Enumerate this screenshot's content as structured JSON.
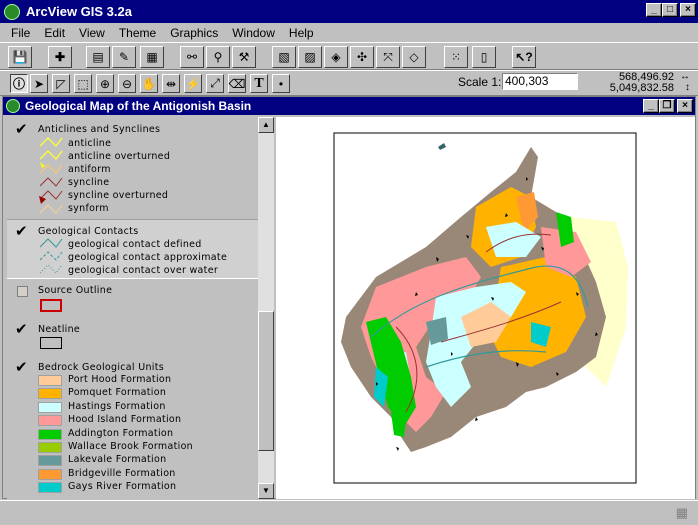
{
  "app": {
    "title": "ArcView GIS 3.2a"
  },
  "menu": [
    "File",
    "Edit",
    "View",
    "Theme",
    "Graphics",
    "Window",
    "Help"
  ],
  "toolbar": {
    "scale_label": "Scale 1:",
    "scale_value": "400,303",
    "x_coord": "568,496.92",
    "y_coord": "5,049,832.58",
    "x_arrow": "↔",
    "y_arrow": "↕"
  },
  "view": {
    "title": "Geological Map of the Antigonish Basin"
  },
  "toc": [
    {
      "name": "Anticlines and Synclines",
      "checked": true,
      "legend": [
        "anticline",
        "anticline overturned",
        "antiform",
        "syncline",
        "syncline overturned",
        "synform"
      ]
    },
    {
      "name": "Geological Contacts",
      "checked": true,
      "legend": [
        "geological contact defined",
        "geological contact approximate",
        "geological contact over water"
      ]
    },
    {
      "name": "Source Outline",
      "checked": false
    },
    {
      "name": "Neatline",
      "checked": true
    },
    {
      "name": "Bedrock Geological Units",
      "checked": true,
      "legend": [
        {
          "label": "Port Hood Formation",
          "color": "#ffcc99"
        },
        {
          "label": "Pomquet Formation",
          "color": "#ffb300"
        },
        {
          "label": "Hastings Formation",
          "color": "#ccffff"
        },
        {
          "label": "Hood Island Formation",
          "color": "#ff9999"
        },
        {
          "label": "Addington Formation",
          "color": "#00cc00"
        },
        {
          "label": "Wallace Brook Formation",
          "color": "#99cc00"
        },
        {
          "label": "Lakevale Formation",
          "color": "#669999"
        },
        {
          "label": "Bridgeville Formation",
          "color": "#ff9933"
        },
        {
          "label": "Gays River Formation",
          "color": "#00cccc"
        }
      ]
    }
  ],
  "icons": {
    "check": "✔",
    "up": "▲",
    "down": "▼"
  }
}
